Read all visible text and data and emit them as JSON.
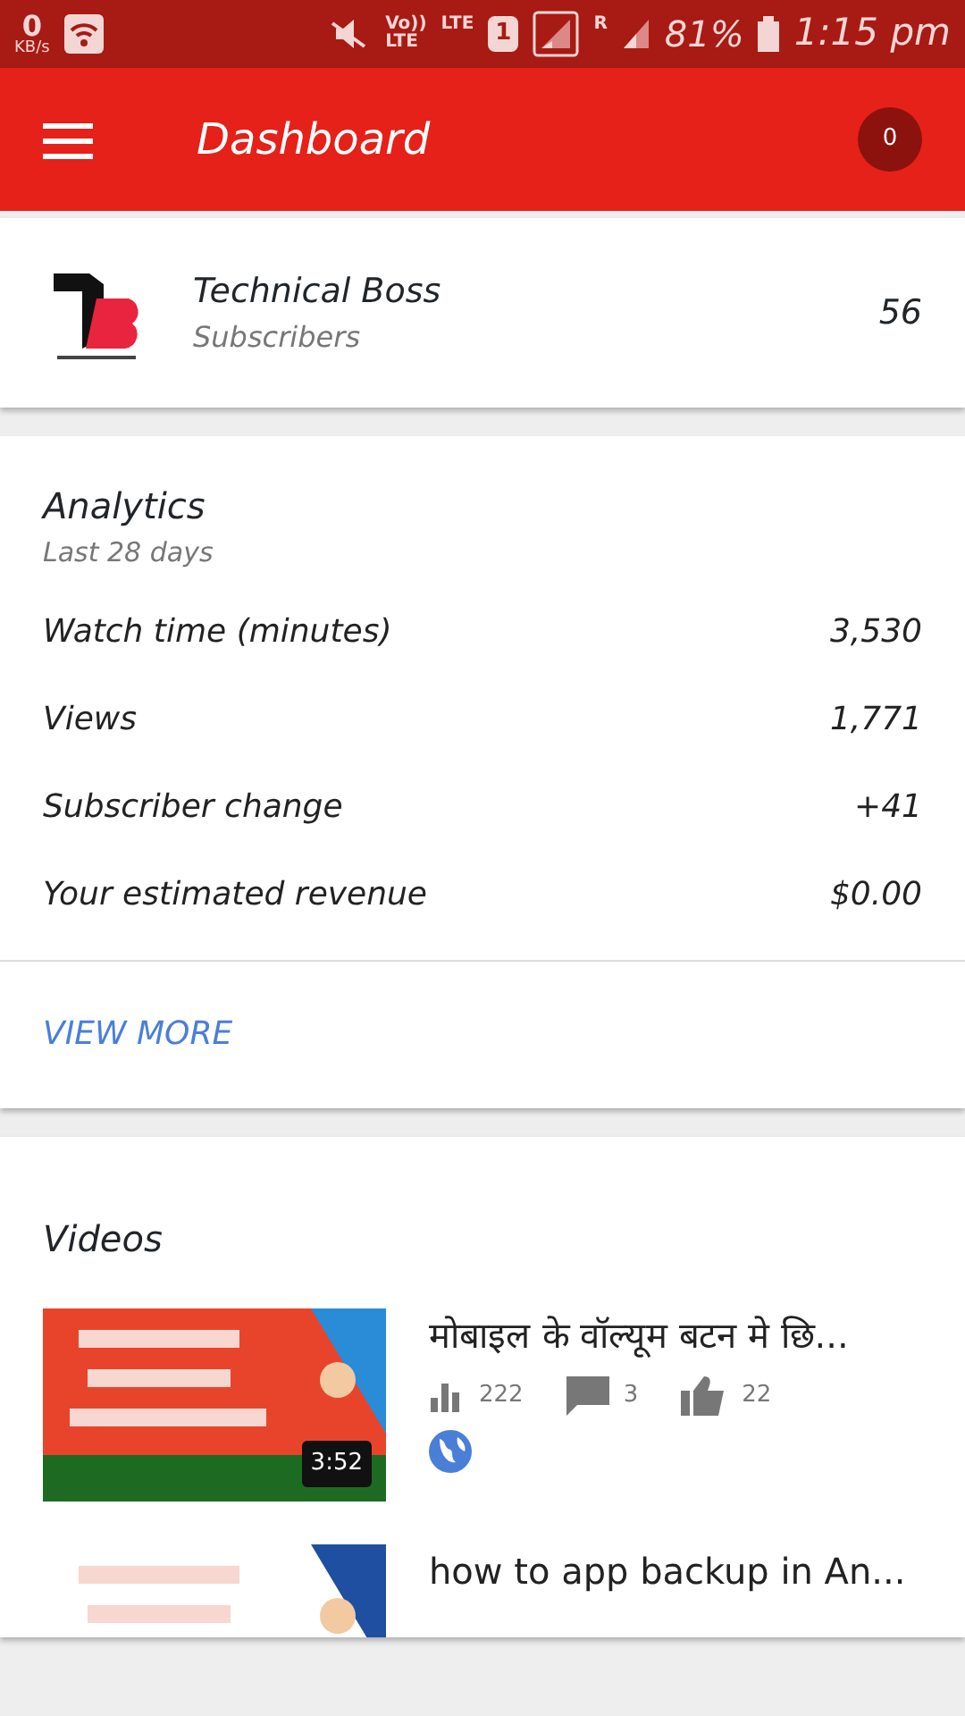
{
  "status_bar": {
    "speed": "0",
    "speed_unit": "KB/s",
    "volte_top": "Vo))",
    "volte_bottom": "LTE",
    "lte": "LTE",
    "sim": "1",
    "roaming": "R",
    "battery": "81%",
    "time": "1:15 pm"
  },
  "app_bar": {
    "title": "Dashboard",
    "notifications": "0"
  },
  "channel": {
    "name": "Technical Boss",
    "subtitle": "Subscribers",
    "count": "56"
  },
  "analytics": {
    "title": "Analytics",
    "period": "Last 28 days",
    "metrics": [
      {
        "label": "Watch time (minutes)",
        "value": "3,530"
      },
      {
        "label": "Views",
        "value": "1,771"
      },
      {
        "label": "Subscriber change",
        "value": "+41"
      },
      {
        "label": "Your estimated revenue",
        "value": "$0.00"
      }
    ],
    "link": "VIEW MORE"
  },
  "videos": {
    "title": "Videos",
    "items": [
      {
        "title": "मोबाइल के वॉल्यूम बटन मे छि...",
        "duration": "3:52",
        "views": "222",
        "comments": "3",
        "likes": "22",
        "public": true
      },
      {
        "title": "how to app backup in An..."
      }
    ]
  }
}
